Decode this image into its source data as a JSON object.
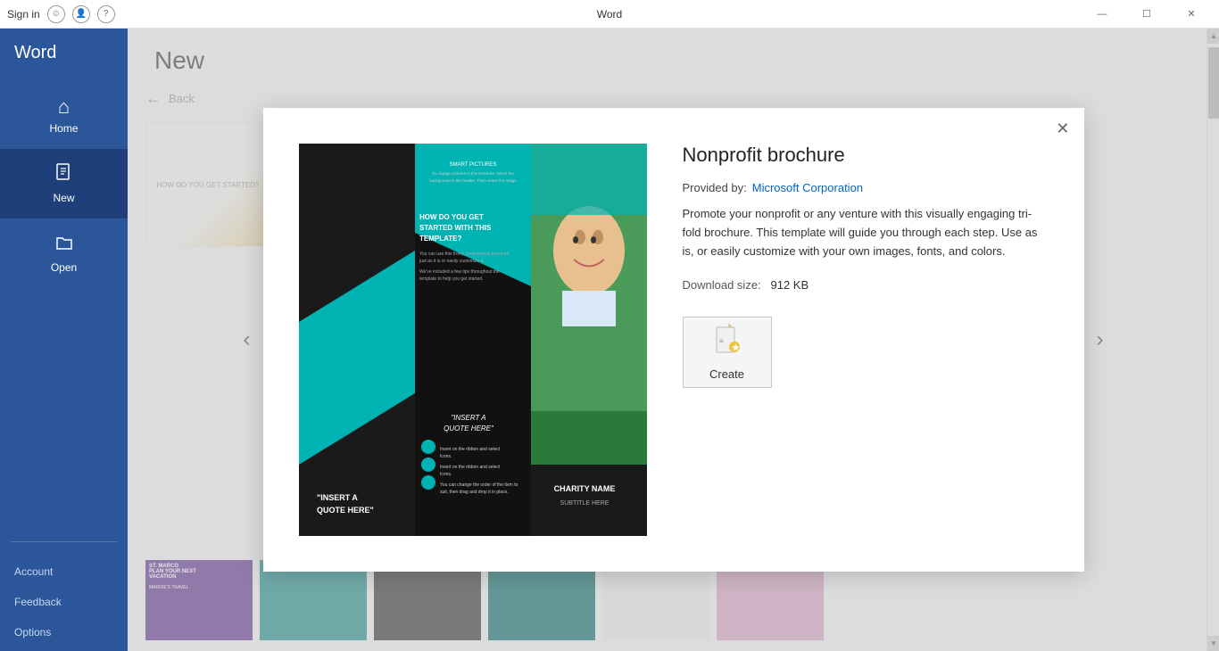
{
  "titleBar": {
    "appName": "Word",
    "signIn": "Sign in",
    "minimizeLabel": "—",
    "maximizeLabel": "☐",
    "closeLabel": "✕",
    "helpLabel": "?"
  },
  "sidebar": {
    "appName": "Word",
    "items": [
      {
        "id": "home",
        "label": "Home",
        "icon": "⌂",
        "active": false
      },
      {
        "id": "new",
        "label": "New",
        "icon": "☐",
        "active": true
      },
      {
        "id": "open",
        "label": "Open",
        "icon": "📁",
        "active": false
      }
    ],
    "bottomItems": [
      {
        "id": "account",
        "label": "Account"
      },
      {
        "id": "feedback",
        "label": "Feedback"
      },
      {
        "id": "options",
        "label": "Options"
      }
    ]
  },
  "mainPage": {
    "title": "New",
    "backLabel": "Back",
    "modal": {
      "templateTitle": "Nonprofit brochure",
      "providedBy": "Provided by:",
      "providerName": "Microsoft Corporation",
      "description": "Promote your nonprofit or any venture with this visually engaging tri-fold brochure. This template will guide you through each step. Use as is, or easily customize with your own images, fonts, and colors.",
      "downloadSizeLabel": "Download size:",
      "downloadSizeValue": "912 KB",
      "createLabel": "Create"
    }
  },
  "colors": {
    "sidebarBg": "#2b579a",
    "sidebarActive": "#1e3f7a",
    "accent": "#0563c1",
    "teal": "#00b3b3",
    "darkBg": "#1a1a2e"
  }
}
